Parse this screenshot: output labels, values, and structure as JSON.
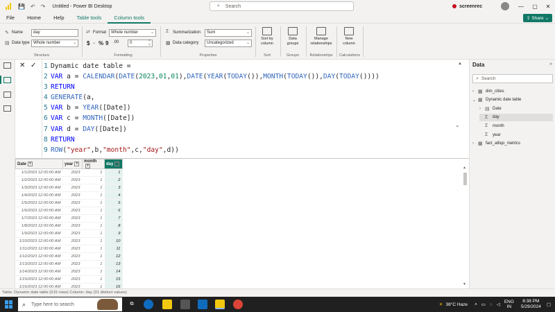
{
  "titlebar": {
    "title": "Untitled - Power BI Desktop",
    "search_placeholder": "Search",
    "recorder_label": "screenrec",
    "min_glyph": "—",
    "max_glyph": "▢",
    "close_glyph": "✕"
  },
  "menu": {
    "items": [
      "File",
      "Home",
      "Help",
      "Table tools",
      "Column tools"
    ],
    "share_label": "Share"
  },
  "ribbon": {
    "name_label": "Name",
    "name_value": "day",
    "datatype_label": "Data type",
    "datatype_value": "Whole number",
    "structure_label": "Structure",
    "format_label": "Format",
    "format_value": "Whole number",
    "currency_glyph": "$",
    "percent_glyph": "%",
    "comma_glyph": "9",
    "decimals_glyph": ".00",
    "decimal_places_value": "0",
    "formatting_label": "Formatting",
    "summarization_label": "Summarization",
    "summarization_value": "Sum",
    "datacategory_label": "Data category",
    "datacategory_value": "Uncategorized",
    "properties_label": "Properties",
    "sort_btn": [
      "Sort by",
      "column"
    ],
    "sort_label": "Sort",
    "groups_btn": [
      "Data",
      "groups"
    ],
    "groups_label": "Groups",
    "rel_btn": [
      "Manage",
      "relationships"
    ],
    "rel_label": "Relationships",
    "calc_btn": [
      "New",
      "column"
    ],
    "calc_label": "Calculations"
  },
  "formula": {
    "lines": [
      [
        {
          "t": "tx",
          "v": "Dynamic date table ="
        }
      ],
      [
        {
          "t": "kw",
          "v": "VAR"
        },
        {
          "t": "tx",
          "v": " a = "
        },
        {
          "t": "fn",
          "v": "CALENDAR"
        },
        {
          "t": "tx",
          "v": "("
        },
        {
          "t": "fn",
          "v": "DATE"
        },
        {
          "t": "tx",
          "v": "("
        },
        {
          "t": "nm",
          "v": "2023"
        },
        {
          "t": "tx",
          "v": ","
        },
        {
          "t": "nm",
          "v": "01"
        },
        {
          "t": "tx",
          "v": ","
        },
        {
          "t": "nm",
          "v": "01"
        },
        {
          "t": "tx",
          "v": "),"
        },
        {
          "t": "fn",
          "v": "DATE"
        },
        {
          "t": "tx",
          "v": "("
        },
        {
          "t": "fn",
          "v": "YEAR"
        },
        {
          "t": "tx",
          "v": "("
        },
        {
          "t": "fn",
          "v": "TODAY"
        },
        {
          "t": "tx",
          "v": "()),"
        },
        {
          "t": "fn",
          "v": "MONTH"
        },
        {
          "t": "tx",
          "v": "("
        },
        {
          "t": "fn",
          "v": "TODAY"
        },
        {
          "t": "tx",
          "v": "()),"
        },
        {
          "t": "fn",
          "v": "DAY"
        },
        {
          "t": "tx",
          "v": "("
        },
        {
          "t": "fn",
          "v": "TODAY"
        },
        {
          "t": "tx",
          "v": "())))"
        }
      ],
      [
        {
          "t": "kw",
          "v": "RETURN"
        }
      ],
      [
        {
          "t": "fn",
          "v": "GENERATE"
        },
        {
          "t": "tx",
          "v": "(a,"
        }
      ],
      [
        {
          "t": "kw",
          "v": "VAR"
        },
        {
          "t": "tx",
          "v": " b = "
        },
        {
          "t": "fn",
          "v": "YEAR"
        },
        {
          "t": "tx",
          "v": "([Date])"
        }
      ],
      [
        {
          "t": "kw",
          "v": "VAR"
        },
        {
          "t": "tx",
          "v": " c = "
        },
        {
          "t": "fn",
          "v": "MONTH"
        },
        {
          "t": "tx",
          "v": "([Date])"
        }
      ],
      [
        {
          "t": "kw",
          "v": "VAR"
        },
        {
          "t": "tx",
          "v": " d = "
        },
        {
          "t": "fn",
          "v": "DAY"
        },
        {
          "t": "tx",
          "v": "([Date])"
        }
      ],
      [
        {
          "t": "kw",
          "v": "RETURN"
        }
      ],
      [
        {
          "t": "fn",
          "v": "ROW"
        },
        {
          "t": "tx",
          "v": "("
        },
        {
          "t": "str",
          "v": "\"year\""
        },
        {
          "t": "tx",
          "v": ",b,"
        },
        {
          "t": "str",
          "v": "\"month\""
        },
        {
          "t": "tx",
          "v": ",c,"
        },
        {
          "t": "str",
          "v": "\"day\""
        },
        {
          "t": "tx",
          "v": ",d))"
        }
      ]
    ]
  },
  "grid": {
    "columns": [
      "Date",
      "year",
      "month",
      "day"
    ],
    "rows": [
      [
        "1/1/2023 12:00:00 AM",
        "2023",
        "1",
        "1"
      ],
      [
        "1/2/2023 12:00:00 AM",
        "2023",
        "1",
        "2"
      ],
      [
        "1/3/2023 12:00:00 AM",
        "2023",
        "1",
        "3"
      ],
      [
        "1/4/2023 12:00:00 AM",
        "2023",
        "1",
        "4"
      ],
      [
        "1/5/2023 12:00:00 AM",
        "2023",
        "1",
        "5"
      ],
      [
        "1/6/2023 12:00:00 AM",
        "2023",
        "1",
        "6"
      ],
      [
        "1/7/2023 12:00:00 AM",
        "2023",
        "1",
        "7"
      ],
      [
        "1/8/2023 12:00:00 AM",
        "2023",
        "1",
        "8"
      ],
      [
        "1/9/2023 12:00:00 AM",
        "2023",
        "1",
        "9"
      ],
      [
        "1/10/2023 12:00:00 AM",
        "2023",
        "1",
        "10"
      ],
      [
        "1/11/2023 12:00:00 AM",
        "2023",
        "1",
        "11"
      ],
      [
        "1/12/2023 12:00:00 AM",
        "2023",
        "1",
        "12"
      ],
      [
        "1/13/2023 12:00:00 AM",
        "2023",
        "1",
        "13"
      ],
      [
        "1/14/2023 12:00:00 AM",
        "2023",
        "1",
        "14"
      ],
      [
        "1/15/2023 12:00:00 AM",
        "2023",
        "1",
        "15"
      ],
      [
        "1/16/2023 12:00:00 AM",
        "2023",
        "1",
        "16"
      ]
    ]
  },
  "datapane": {
    "title": "Data",
    "search_placeholder": "Search",
    "tree": [
      {
        "label": "dim_cities",
        "kind": "table",
        "expanded": false,
        "indent": 0
      },
      {
        "label": "Dynamic date table",
        "kind": "table",
        "expanded": true,
        "indent": 0
      },
      {
        "label": "Date",
        "kind": "date",
        "expanded": false,
        "indent": 1
      },
      {
        "label": "day",
        "kind": "sum",
        "selected": true,
        "indent": 1
      },
      {
        "label": "month",
        "kind": "sum",
        "indent": 1
      },
      {
        "label": "year",
        "kind": "sum",
        "indent": 1
      },
      {
        "label": "fact_atliqo_metrics",
        "kind": "table",
        "expanded": false,
        "indent": 0
      }
    ]
  },
  "statusbar": {
    "text": "Table: Dynamic date table (515 rows) Column: day (31 distinct values)"
  },
  "taskbar": {
    "search_placeholder": "Type here to search",
    "weather": "38°C  Haze",
    "lang_top": "ENG",
    "lang_bottom": "IN",
    "time": "8:38 PM",
    "date": "5/29/2024"
  },
  "colors": {
    "accent": "#117865",
    "keyword": "#0000ff",
    "function": "#3165bb",
    "number": "#098658",
    "string": "#a31515"
  }
}
